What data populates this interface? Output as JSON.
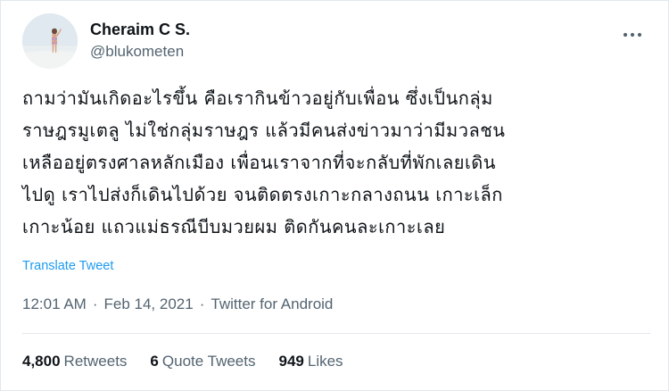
{
  "author": {
    "display_name": "Cheraim C S.",
    "handle": "@blukometen",
    "avatar_icon": "profile-avatar"
  },
  "menu_icon": "more-options-icon",
  "tweet": {
    "text": "ถามว่ามันเกิดอะไรขึ้น คือเรากินข้าวอยู่กับเพื่อน ซึ่งเป็นกลุ่ม\nราษฎรมูเตลู ไม่ใช่กลุ่มราษฎร แล้วมีคนส่งข่าวมาว่ามีมวลชน\nเหลืออยู่ตรงศาลหลักเมือง เพื่อนเราจากที่จะกลับที่พักเลยเดิน\nไปดู เราไปส่งก็เดินไปด้วย จนติดตรงเกาะกลางถนน เกาะเล็ก\nเกาะน้อย แถวแม่ธรณีบีบมวยผม ติดกันคนละเกาะเลย",
    "translate_label": "Translate Tweet"
  },
  "meta": {
    "time": "12:01 AM",
    "date": "Feb 14, 2021",
    "separator": "·",
    "source": "Twitter for Android"
  },
  "stats": {
    "retweets_count": "4,800",
    "retweets_label": "Retweets",
    "quotes_count": "6",
    "quotes_label": "Quote Tweets",
    "likes_count": "949",
    "likes_label": "Likes"
  },
  "colors": {
    "link": "#1d9bf0",
    "secondary_text": "#536471",
    "primary_text": "#0f1419",
    "divider": "#e1e8ed"
  }
}
